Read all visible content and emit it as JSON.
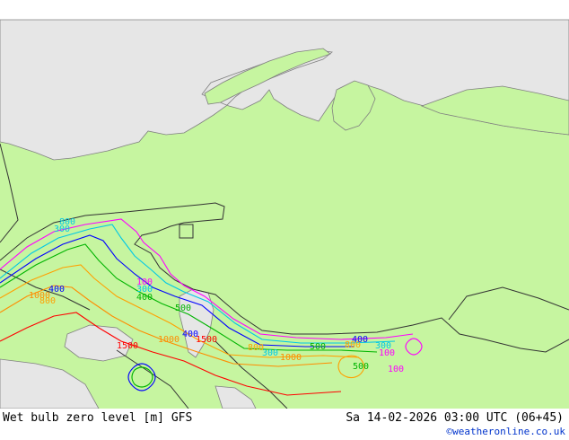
{
  "footer": {
    "title": "Wet bulb zero level [m] GFS",
    "datetime": "Sa 14-02-2026 03:00 UTC (06+45)",
    "credit": "©weatheronline.co.uk"
  },
  "colors": {
    "land": "#c6f5a0",
    "sea": "#e6e6e6",
    "border": "#333333",
    "coast": "#808080",
    "c100": "#ff00ff",
    "c300": "#00c8e6",
    "c400": "#0000ff",
    "c500": "#00b400",
    "c800": "#ffa000",
    "c1000": "#ff8c00",
    "c1500": "#ff0000"
  },
  "contour_labels": [
    {
      "text": "800",
      "color": "c300"
    },
    {
      "text": "300",
      "color": "c300"
    },
    {
      "text": "100",
      "color": "c100"
    },
    {
      "text": "400",
      "color": "c400"
    },
    {
      "text": "300",
      "color": "c300"
    },
    {
      "text": "400",
      "color": "c500"
    },
    {
      "text": "1000",
      "color": "c1000"
    },
    {
      "text": "800",
      "color": "c800"
    },
    {
      "text": "500",
      "color": "c500"
    },
    {
      "text": "400",
      "color": "c400"
    },
    {
      "text": "1000",
      "color": "c1000"
    },
    {
      "text": "1500",
      "color": "c1500"
    },
    {
      "text": "1500",
      "color": "c1500"
    },
    {
      "text": "800",
      "color": "c800"
    },
    {
      "text": "300",
      "color": "c300"
    },
    {
      "text": "1000",
      "color": "c1000"
    },
    {
      "text": "500",
      "color": "c500"
    },
    {
      "text": "800",
      "color": "c800"
    },
    {
      "text": "400",
      "color": "c400"
    },
    {
      "text": "300",
      "color": "c300"
    },
    {
      "text": "500",
      "color": "c500"
    },
    {
      "text": "100",
      "color": "c100"
    },
    {
      "text": "100",
      "color": "c100"
    }
  ]
}
